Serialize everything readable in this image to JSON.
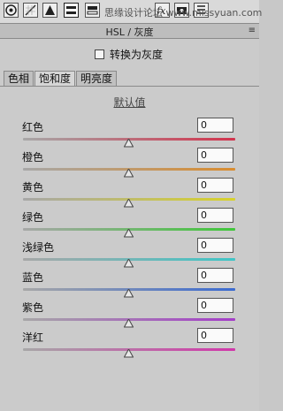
{
  "watermark": "思缘设计论坛 www.missyuan.com",
  "panel": {
    "title": "HSL / 灰度",
    "menu_icon": "panel-menu-icon"
  },
  "toolbar": {
    "icons": [
      "basic-aperture-icon",
      "tone-curve-icon",
      "detail-triangle-icon",
      "hsl-grayscale-icon",
      "split-toning-icon",
      "lens-correction-icon",
      "fx-icon",
      "camera-icon",
      "presets-icon",
      "snapshots-icon"
    ]
  },
  "grayscale": {
    "label": "转换为灰度",
    "checked": false
  },
  "tabs": [
    {
      "label": "色相",
      "active": false
    },
    {
      "label": "饱和度",
      "active": true
    },
    {
      "label": "明亮度",
      "active": false
    }
  ],
  "default_label": "默认值",
  "sliders": [
    {
      "label": "红色",
      "value": "0",
      "track_from": "#a7a7a7",
      "track_to": "#d2334d"
    },
    {
      "label": "橙色",
      "value": "0",
      "track_from": "#a7a7a7",
      "track_to": "#d98c2f"
    },
    {
      "label": "黄色",
      "value": "0",
      "track_from": "#a7a7a7",
      "track_to": "#d8d22a"
    },
    {
      "label": "绿色",
      "value": "0",
      "track_from": "#a7a7a7",
      "track_to": "#3fc63a"
    },
    {
      "label": "浅绿色",
      "value": "0",
      "track_from": "#a7a7a7",
      "track_to": "#3ec5c6"
    },
    {
      "label": "蓝色",
      "value": "0",
      "track_from": "#a7a7a7",
      "track_to": "#3a6ad0"
    },
    {
      "label": "紫色",
      "value": "0",
      "track_from": "#a7a7a7",
      "track_to": "#a43cc8"
    },
    {
      "label": "洋红",
      "value": "0",
      "track_from": "#a7a7a7",
      "track_to": "#d136a9"
    }
  ],
  "slider_range": [
    -100,
    100
  ]
}
